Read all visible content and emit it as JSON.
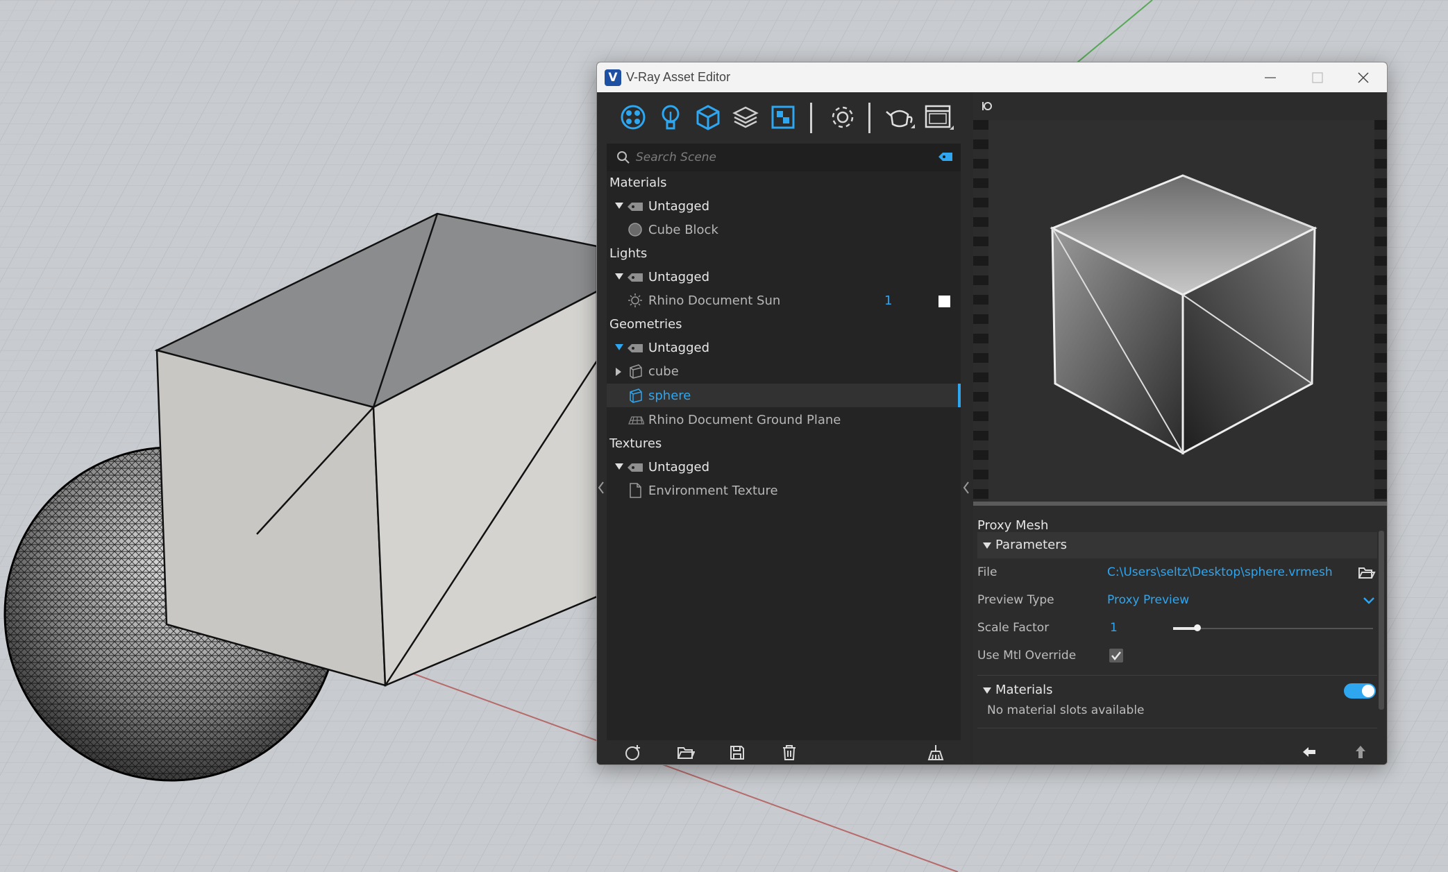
{
  "window": {
    "title": "V-Ray Asset Editor",
    "logo_letter": "V",
    "controls": [
      "minimize",
      "maximize",
      "close"
    ]
  },
  "toolbar": {
    "icons": [
      "materials-icon",
      "lights-icon",
      "geometry-icon",
      "render-elements-icon",
      "textures-icon",
      "settings-icon",
      "render-teapot-icon",
      "frame-buffer-icon"
    ]
  },
  "search": {
    "placeholder": "Search Scene"
  },
  "tree": {
    "materials": {
      "label": "Materials",
      "group": "Untagged",
      "items": [
        "Cube Block"
      ]
    },
    "lights": {
      "label": "Lights",
      "group": "Untagged",
      "items": [
        {
          "name": "Rhino Document Sun",
          "count": "1"
        }
      ]
    },
    "geometries": {
      "label": "Geometries",
      "group": "Untagged",
      "items": [
        "cube",
        "sphere",
        "Rhino Document Ground Plane"
      ]
    },
    "textures": {
      "label": "Textures",
      "group": "Untagged",
      "items": [
        "Environment Texture"
      ]
    }
  },
  "props": {
    "title": "Proxy Mesh",
    "parameters_label": "Parameters",
    "file_label": "File",
    "file_value": "C:\\Users\\seltz\\Desktop\\sphere.vrmesh",
    "preview_type_label": "Preview Type",
    "preview_type_value": "Proxy Preview",
    "scale_label": "Scale Factor",
    "scale_value": "1",
    "scale_slider_fraction": 0.12,
    "mtl_override_label": "Use Mtl Override",
    "mtl_override_checked": true,
    "materials_label": "Materials",
    "materials_toggle_on": true,
    "no_slots": "No material slots available"
  },
  "colors": {
    "accent": "#2ea6f0",
    "panel": "#2b2b2b"
  }
}
